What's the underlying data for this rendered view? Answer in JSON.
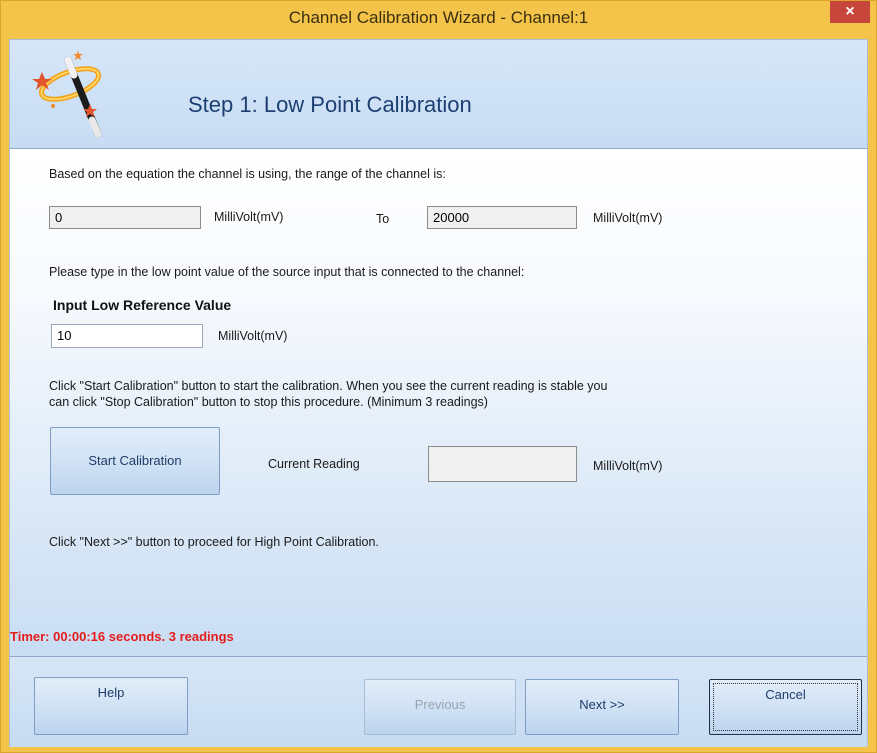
{
  "window": {
    "title": "Channel Calibration Wizard - Channel:1",
    "close_glyph": "×"
  },
  "header": {
    "icon": "magic-wand-icon",
    "step_title": "Step 1: Low Point Calibration"
  },
  "range": {
    "intro": "Based on the equation the channel is using, the range of the channel is:",
    "low_value": "0",
    "low_unit": "MilliVolt(mV)",
    "to_label": "To",
    "high_value": "20000",
    "high_unit": "MilliVolt(mV)"
  },
  "low_point": {
    "instruction": "Please type in the low point value of the source input that is connected to the channel:",
    "heading": "Input Low Reference Value",
    "value": "10",
    "unit": "MilliVolt(mV)"
  },
  "calibration": {
    "instruction_line1": "Click \"Start Calibration\" button to start the calibration.  When you see the current reading is stable you",
    "instruction_line2": "can click \"Stop Calibration\" button to stop this procedure. (Minimum 3 readings)",
    "start_button": "Start Calibration",
    "reading_label": "Current Reading",
    "reading_value": "",
    "reading_unit": "MilliVolt(mV)",
    "next_hint": "Click \"Next >>\" button to proceed for High Point Calibration."
  },
  "status": {
    "timer": "Timer: 00:00:16 seconds. 3 readings",
    "color": "#e41c1c"
  },
  "footer": {
    "help": "Help",
    "previous": "Previous",
    "next": "Next >>",
    "cancel": "Cancel"
  },
  "colors": {
    "title_bar": "#f4c44a",
    "close_button": "#c7463b",
    "accent_text": "#1e3f72"
  }
}
